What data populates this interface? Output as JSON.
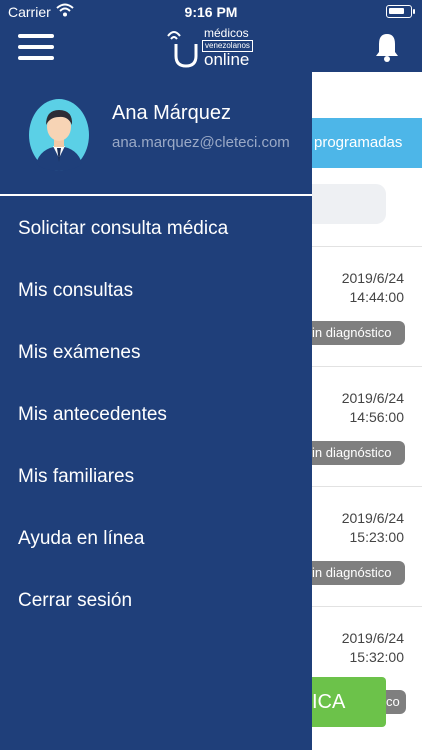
{
  "status_bar": {
    "carrier": "Carrier",
    "time": "9:16 PM"
  },
  "header": {
    "logo": {
      "line1": "médicos",
      "line2": "venezolanos",
      "line3": "online"
    }
  },
  "drawer": {
    "user": {
      "name": "Ana Márquez",
      "email": "ana.marquez@cleteci.com"
    },
    "menu": [
      {
        "label": "Solicitar consulta médica"
      },
      {
        "label": "Mis consultas"
      },
      {
        "label": "Mis exámenes"
      },
      {
        "label": "Mis antecedentes"
      },
      {
        "label": "Mis familiares"
      },
      {
        "label": "Ayuda en línea"
      },
      {
        "label": "Cerrar sesión"
      }
    ]
  },
  "background": {
    "tab_label": "programadas",
    "items": [
      {
        "date": "2019/6/24",
        "time": "14:44:00",
        "badge": "in diagnóstico"
      },
      {
        "date": "2019/6/24",
        "time": "14:56:00",
        "badge": "in diagnóstico"
      },
      {
        "date": "2019/6/24",
        "time": "15:23:00",
        "badge": "in diagnóstico"
      },
      {
        "date": "2019/6/24",
        "time": "15:32:00",
        "badge": "co"
      }
    ],
    "green_button": "ICA"
  },
  "colors": {
    "primary": "#1f3f7a",
    "accent": "#4db6e8",
    "green": "#6cc24a",
    "badge": "#7f7f7f"
  }
}
